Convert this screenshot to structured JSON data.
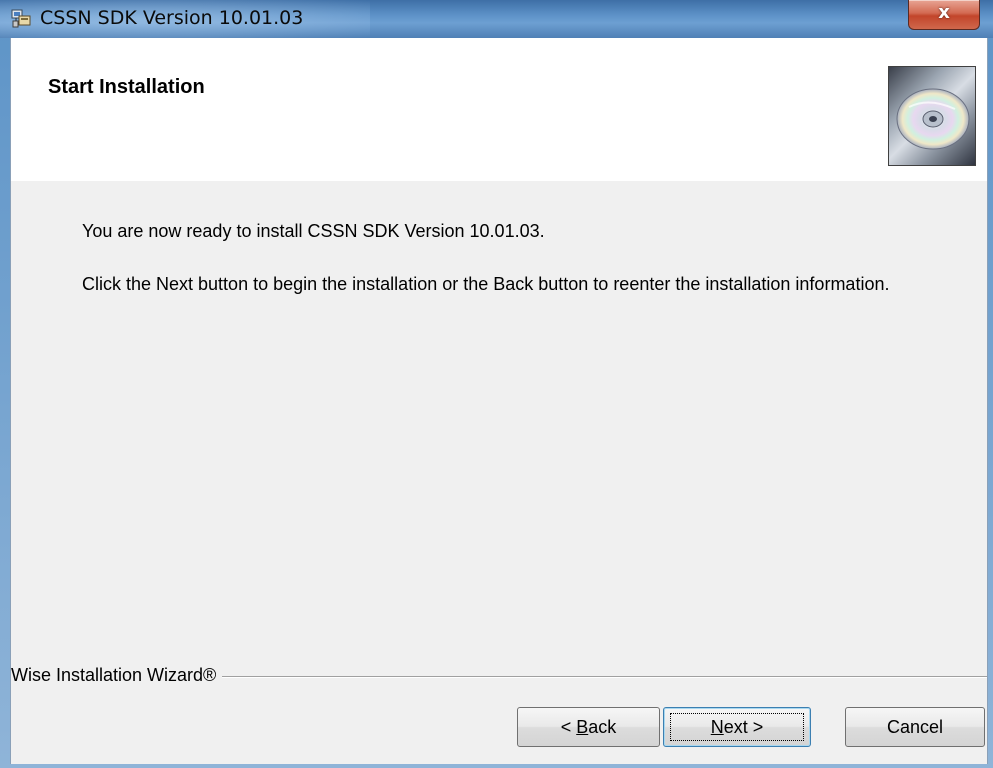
{
  "window": {
    "title": "CSSN SDK Version 10.01.03",
    "close_label": "x"
  },
  "header": {
    "title": "Start Installation",
    "graphic_icon": "cd-disc-icon"
  },
  "body": {
    "line1": "You are now ready to install CSSN SDK Version 10.01.03.",
    "line2": "Click the Next button to begin the installation or the Back button to reenter the installation information."
  },
  "branding": {
    "text": "Wise Installation Wizard®"
  },
  "buttons": {
    "back_pre": "< ",
    "back_mnemonic": "B",
    "back_post": "ack",
    "next_mnemonic": "N",
    "next_post": "ext >",
    "cancel": "Cancel"
  },
  "colors": {
    "titlebar": "#5d92c8",
    "client_bg": "#f0f0f0",
    "close_button": "#c2452b"
  }
}
